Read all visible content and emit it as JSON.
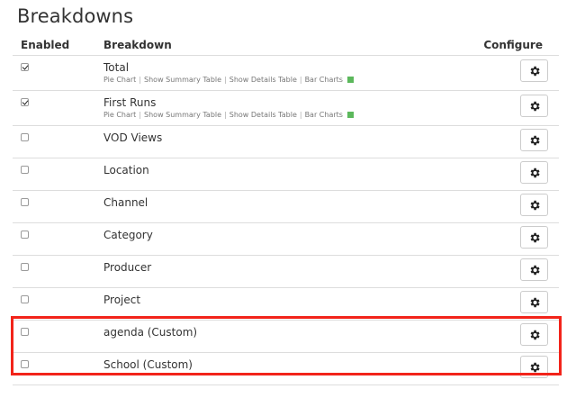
{
  "page": {
    "title": "Breakdowns"
  },
  "columns": {
    "enabled": "Enabled",
    "breakdown": "Breakdown",
    "configure": "Configure"
  },
  "links": {
    "pie_chart": "Pie Chart",
    "summary_table": "Show Summary Table",
    "details_table": "Show Details Table",
    "bar_charts": "Bar Charts",
    "separator": "|"
  },
  "rows": [
    {
      "name": "Total",
      "enabled": true,
      "has_links": true
    },
    {
      "name": "First Runs",
      "enabled": true,
      "has_links": true
    },
    {
      "name": "VOD Views",
      "enabled": false,
      "has_links": false
    },
    {
      "name": "Location",
      "enabled": false,
      "has_links": false
    },
    {
      "name": "Channel",
      "enabled": false,
      "has_links": false
    },
    {
      "name": "Category",
      "enabled": false,
      "has_links": false
    },
    {
      "name": "Producer",
      "enabled": false,
      "has_links": false
    },
    {
      "name": "Project",
      "enabled": false,
      "has_links": false
    },
    {
      "name": "agenda (Custom)",
      "enabled": false,
      "has_links": false
    },
    {
      "name": "School (Custom)",
      "enabled": false,
      "has_links": false
    }
  ],
  "icons": {
    "configure": "gear-icon",
    "status": "green-square-icon"
  },
  "colors": {
    "status_green": "#5cb85c",
    "highlight": "#f2241a"
  }
}
